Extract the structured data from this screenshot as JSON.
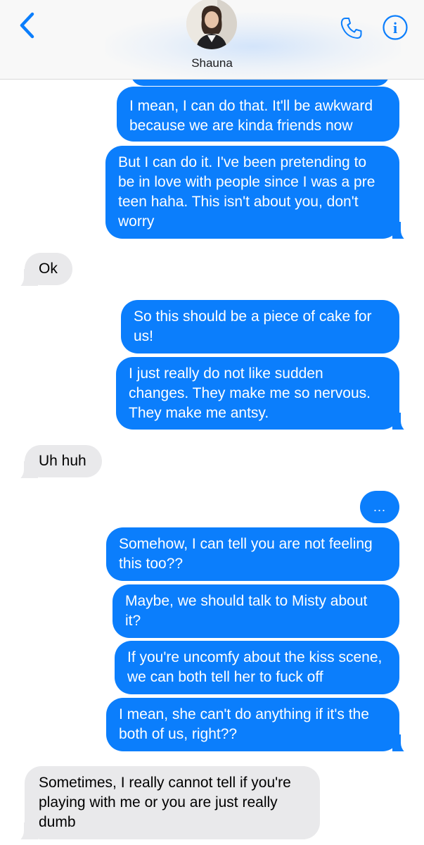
{
  "header": {
    "contact_name": "Shauna",
    "back_icon": "chevron-left-icon",
    "call_icon": "phone-icon",
    "info_icon": "info-icon",
    "accent_color": "#0b7efc"
  },
  "messages": [
    {
      "sender": "me",
      "text": "I mean, I can do that. It'll be awkward because we are kinda friends now"
    },
    {
      "sender": "me",
      "text": "But I can do it. I've been pretending to be in love with people since I was a pre teen haha. This isn't about you, don't worry"
    },
    {
      "sender": "them",
      "text": "Ok"
    },
    {
      "sender": "me",
      "text": "So this should be a piece of cake for us!"
    },
    {
      "sender": "me",
      "text": "I just really do not like sudden changes. They make me so nervous. They make me antsy."
    },
    {
      "sender": "them",
      "text": "Uh huh"
    },
    {
      "sender": "me",
      "text": "..."
    },
    {
      "sender": "me",
      "text": "Somehow, I can tell you are not feeling this too??"
    },
    {
      "sender": "me",
      "text": "Maybe, we should talk to Misty about it?"
    },
    {
      "sender": "me",
      "text": "If you're uncomfy about the kiss scene, we can both tell her to fuck off"
    },
    {
      "sender": "me",
      "text": "I mean, she can't do anything if it's the both of us, right??"
    },
    {
      "sender": "them",
      "text": "Sometimes, I really cannot tell if you're playing with me or you are just really dumb"
    }
  ],
  "colors": {
    "sent_bubble": "#0b7efc",
    "received_bubble": "#e9e9eb"
  }
}
